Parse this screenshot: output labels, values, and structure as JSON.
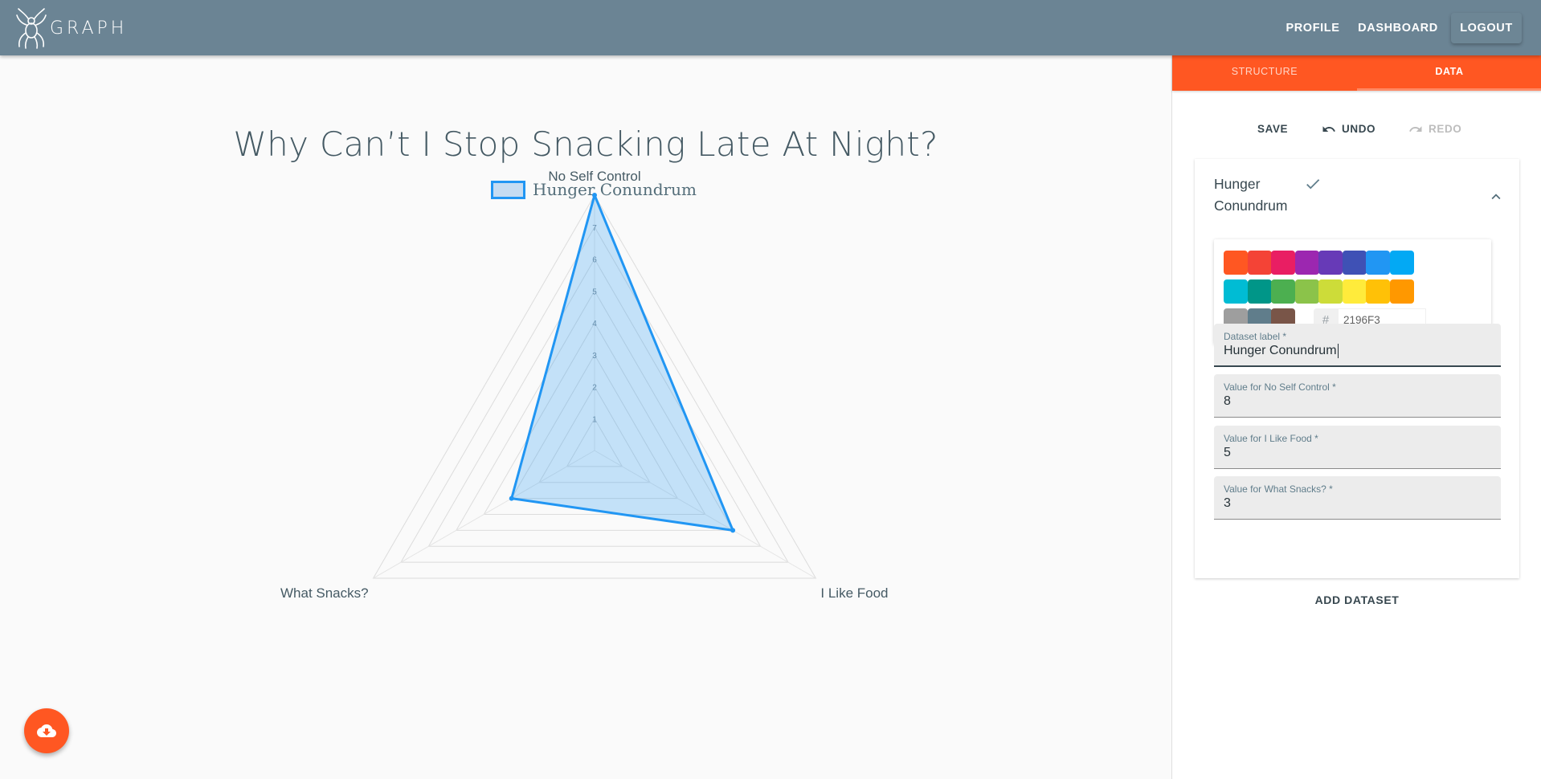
{
  "app": {
    "logo_text": "GRAPH"
  },
  "nav": {
    "profile": "PROFILE",
    "dashboard": "DASHBOARD",
    "logout": "LOGOUT"
  },
  "tabs": [
    {
      "label": "STRUCTURE",
      "active": false
    },
    {
      "label": "DATA",
      "active": true
    }
  ],
  "toolbar": {
    "save": "SAVE",
    "undo": "UNDO",
    "redo": "REDO"
  },
  "dataset_card": {
    "title": "Hunger Conundrum",
    "color_hex": "2196F3",
    "palette": [
      "#ff5722",
      "#f44336",
      "#e91e63",
      "#9c27b0",
      "#673ab7",
      "#3f51b5",
      "#2196f3",
      "#03a9f4",
      "#00bcd4",
      "#009688",
      "#4caf50",
      "#8bc34a",
      "#cddc39",
      "#ffeb3b",
      "#ffc107",
      "#ff9800",
      "#9e9e9e",
      "#607d8b",
      "#795548"
    ],
    "fields": [
      {
        "label": "Dataset label *",
        "value": "Hunger Conundrum"
      },
      {
        "label": "Value for No Self Control *",
        "value": "8"
      },
      {
        "label": "Value for I Like Food *",
        "value": "5"
      },
      {
        "label": "Value for What Snacks? *",
        "value": "3"
      }
    ]
  },
  "add_dataset": "ADD DATASET",
  "chart_data": {
    "type": "radar",
    "title": "Why Can’t I Stop Snacking Late At Night?",
    "categories": [
      "No Self Control",
      "I Like Food",
      "What Snacks?"
    ],
    "series": [
      {
        "name": "Hunger Conundrum",
        "values": [
          8,
          5,
          3
        ],
        "color": "#2196F3"
      }
    ],
    "r_min": 0,
    "r_max": 8,
    "tick_labels": [
      "1",
      "2",
      "3",
      "4",
      "5",
      "6",
      "7"
    ],
    "legend_position": "top"
  },
  "colors": {
    "topbar": "#6b8494",
    "accent": "#ff5722",
    "series": "#2196f3"
  },
  "icons": {
    "logo": "spider-logo-icon",
    "download": "cloud-download-icon",
    "check": "check-icon",
    "collapse": "chevron-up-icon",
    "undo": "undo-icon",
    "redo": "redo-icon"
  }
}
